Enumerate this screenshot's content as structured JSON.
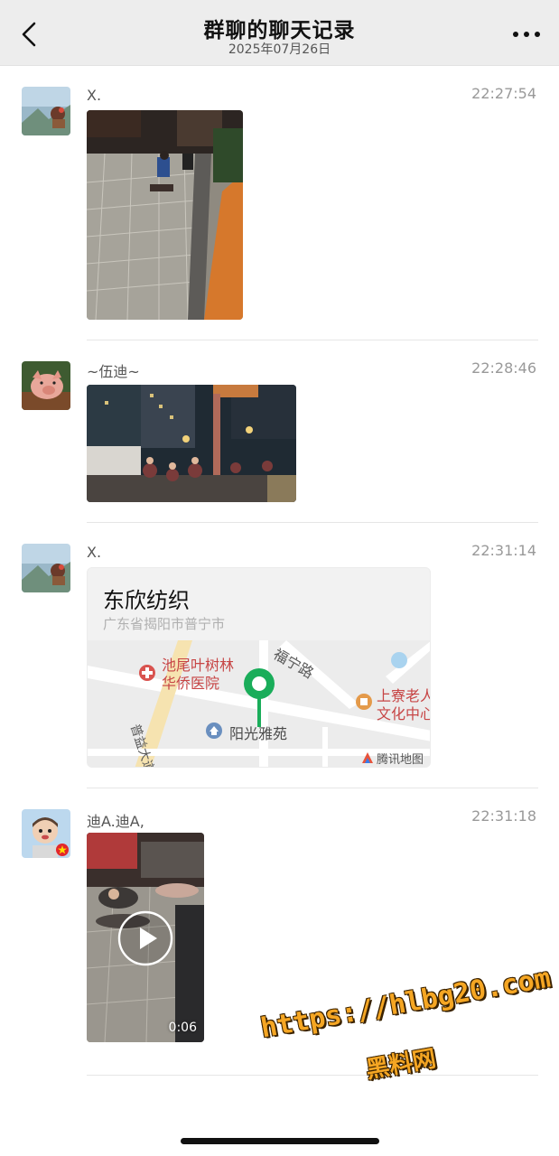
{
  "header": {
    "title": "群聊的聊天记录",
    "date": "2025年07月26日",
    "back_icon": "chevron-left-icon",
    "more_icon": "more-dots-icon"
  },
  "records": [
    {
      "sender": "X.",
      "time": "22:27:54",
      "type": "image"
    },
    {
      "sender": "~伍迪~",
      "time": "22:28:46",
      "type": "image"
    },
    {
      "sender": "X.",
      "time": "22:31:14",
      "type": "location",
      "location": {
        "name": "东欣纺织",
        "address": "广东省揭阳市普宁市",
        "map_labels": {
          "hospital_line1": "池尾叶树林",
          "hospital_line2": "华侨医院",
          "road_top": "福宁路",
          "estate": "阳光雅苑",
          "culture_line1": "上寮老人",
          "culture_line2": "文化中心",
          "road_side": "普益大道",
          "provider": "腾讯地图"
        }
      }
    },
    {
      "sender": "迪A.迪A,",
      "time": "22:31:18",
      "type": "video",
      "duration": "0:06"
    }
  ],
  "watermark": {
    "url": "https://hlbg20.com",
    "site": "黑料网"
  },
  "colors": {
    "header_bg": "#ededed",
    "map_pin": "#1aad5a",
    "watermark": "#f5a623"
  }
}
